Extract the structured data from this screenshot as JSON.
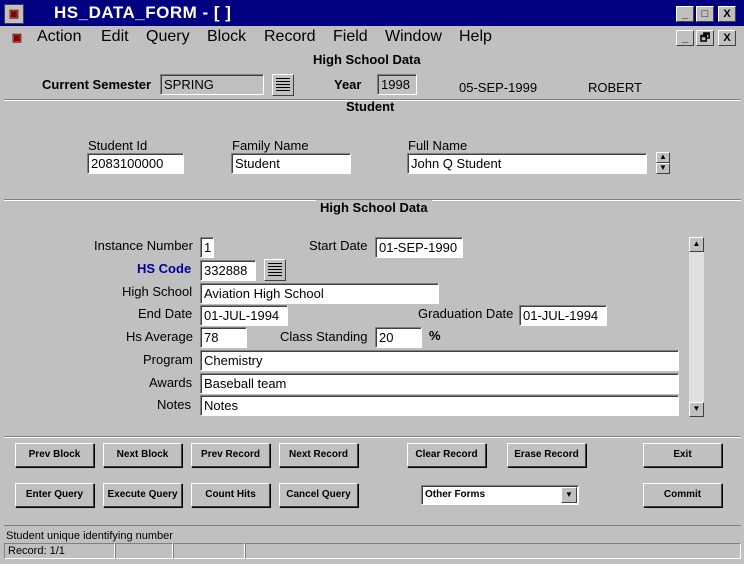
{
  "window": {
    "title": "HS_DATA_FORM - [ ]",
    "app_icon": "oracle-forms-icon",
    "controls": [
      "_",
      "□",
      "X"
    ],
    "mdi_controls": [
      "_",
      "🗗",
      "X"
    ]
  },
  "menu": {
    "items": [
      "Action",
      "Edit",
      "Query",
      "Block",
      "Record",
      "Field",
      "Window",
      "Help"
    ]
  },
  "header": {
    "form_title": "High School Data",
    "semester_label": "Current Semester",
    "semester_value": "SPRING",
    "year_label": "Year",
    "year_value": "1998",
    "date_value": "05-SEP-1999",
    "user_value": "ROBERT"
  },
  "student": {
    "section_title": "Student",
    "student_id_label": "Student Id",
    "student_id_value": "2083100000",
    "family_name_label": "Family Name",
    "family_name_value": "Student",
    "full_name_label": "Full Name",
    "full_name_value": "John Q Student"
  },
  "hs": {
    "section_title": "High School Data",
    "instance_label": "Instance Number",
    "instance_value": "1",
    "start_date_label": "Start Date",
    "start_date_value": "01-SEP-1990",
    "hs_code_label": "HS Code",
    "hs_code_value": "332888",
    "high_school_label": "High School",
    "high_school_value": "Aviation High School",
    "end_date_label": "End Date",
    "end_date_value": "01-JUL-1994",
    "graduation_label": "Graduation Date",
    "graduation_value": "01-JUL-1994",
    "average_label": "Hs Average",
    "average_value": "78",
    "class_standing_label": "Class Standing",
    "class_standing_value": "20",
    "percent_sign": "%",
    "program_label": "Program",
    "program_value": "Chemistry",
    "awards_label": "Awards",
    "awards_value": "Baseball team",
    "notes_label": "Notes",
    "notes_value": "Notes"
  },
  "buttons": {
    "prev_block": "Prev Block",
    "next_block": "Next Block",
    "prev_record": "Prev Record",
    "next_record": "Next Record",
    "clear_record": "Clear Record",
    "erase_record": "Erase Record",
    "exit": "Exit",
    "enter_query": "Enter Query",
    "execute_query": "Execute Query",
    "count_hits": "Count Hits",
    "cancel_query": "Cancel Query",
    "other_forms": "Other Forms",
    "commit": "Commit"
  },
  "status": {
    "hint": "Student unique identifying number",
    "record": "Record: 1/1"
  }
}
